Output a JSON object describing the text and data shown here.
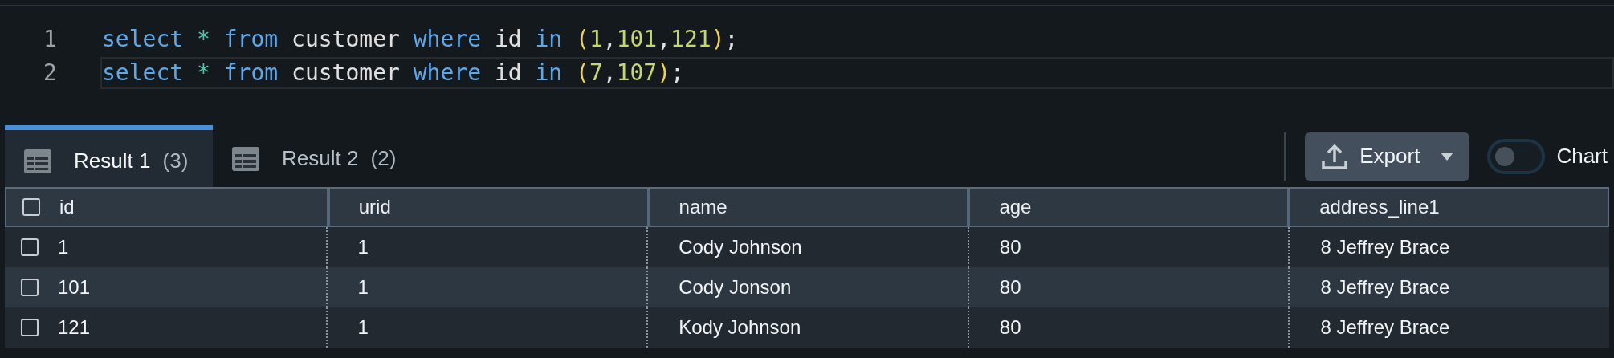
{
  "editor": {
    "lines": [
      {
        "number": "1",
        "active": false,
        "tokens": [
          {
            "text": "select ",
            "kind": "keyword"
          },
          {
            "text": "* ",
            "kind": "operator"
          },
          {
            "text": "from",
            "kind": "keyword"
          },
          {
            "text": " customer ",
            "kind": "plain"
          },
          {
            "text": "where",
            "kind": "keyword"
          },
          {
            "text": " id ",
            "kind": "plain"
          },
          {
            "text": "in ",
            "kind": "keyword"
          },
          {
            "text": "(",
            "kind": "paren"
          },
          {
            "text": "1",
            "kind": "number"
          },
          {
            "text": ",",
            "kind": "plain"
          },
          {
            "text": "101",
            "kind": "number"
          },
          {
            "text": ",",
            "kind": "plain"
          },
          {
            "text": "121",
            "kind": "number"
          },
          {
            "text": ")",
            "kind": "paren"
          },
          {
            "text": ";",
            "kind": "plain"
          }
        ]
      },
      {
        "number": "2",
        "active": true,
        "tokens": [
          {
            "text": "select ",
            "kind": "keyword"
          },
          {
            "text": "* ",
            "kind": "operator"
          },
          {
            "text": "from",
            "kind": "keyword"
          },
          {
            "text": " customer ",
            "kind": "plain"
          },
          {
            "text": "where",
            "kind": "keyword"
          },
          {
            "text": " id ",
            "kind": "plain"
          },
          {
            "text": "in ",
            "kind": "keyword"
          },
          {
            "text": "(",
            "kind": "paren"
          },
          {
            "text": "7",
            "kind": "number"
          },
          {
            "text": ",",
            "kind": "plain"
          },
          {
            "text": "107",
            "kind": "number"
          },
          {
            "text": ")",
            "kind": "paren"
          },
          {
            "text": ";",
            "kind": "plain"
          }
        ]
      }
    ]
  },
  "tabs": [
    {
      "label": "Result 1",
      "count": "(3)",
      "selected": true
    },
    {
      "label": "Result 2",
      "count": "(2)",
      "selected": false
    }
  ],
  "toolbar": {
    "export_button": "Export",
    "chart_toggle": {
      "label": "Chart",
      "on": false
    }
  },
  "table": {
    "header_checked": false,
    "columns": [
      "id",
      "urid",
      "name",
      "age",
      "address_line1"
    ],
    "rows": [
      {
        "checked": false,
        "cells": [
          "1",
          "1",
          "Cody Johnson",
          "80",
          "8 Jeffrey Brace"
        ]
      },
      {
        "checked": false,
        "cells": [
          "101",
          "1",
          "Cody Jonson",
          "80",
          "8 Jeffrey Brace"
        ]
      },
      {
        "checked": false,
        "cells": [
          "121",
          "1",
          "Kody Johnson",
          "80",
          "8 Jeffrey Brace"
        ]
      }
    ]
  }
}
